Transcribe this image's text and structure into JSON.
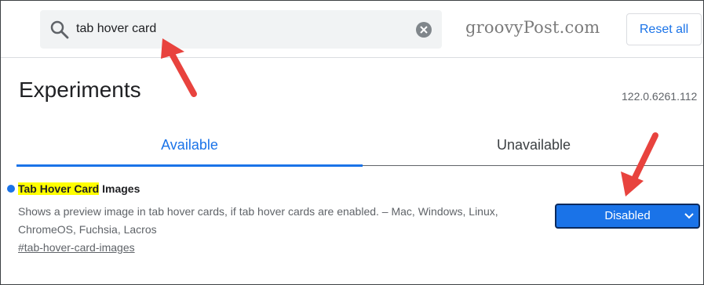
{
  "search": {
    "query": "tab hover card"
  },
  "watermark": "groovyPost.com",
  "header": {
    "reset_label": "Reset all"
  },
  "page": {
    "title": "Experiments",
    "version": "122.0.6261.112"
  },
  "tabs": [
    {
      "label": "Available",
      "selected": true
    },
    {
      "label": "Unavailable",
      "selected": false
    }
  ],
  "experiment": {
    "name_highlight": "Tab Hover Card",
    "name_rest": " Images",
    "description": "Shows a preview image in tab hover cards, if tab hover cards are enabled. – Mac, Windows, Linux, ChromeOS, Fuchsia, Lacros",
    "link": "#tab-hover-card-images",
    "state": "Disabled"
  },
  "colors": {
    "accent": "#1a73e8",
    "annotation_arrow": "#e8433e",
    "highlight": "#ffff00"
  }
}
